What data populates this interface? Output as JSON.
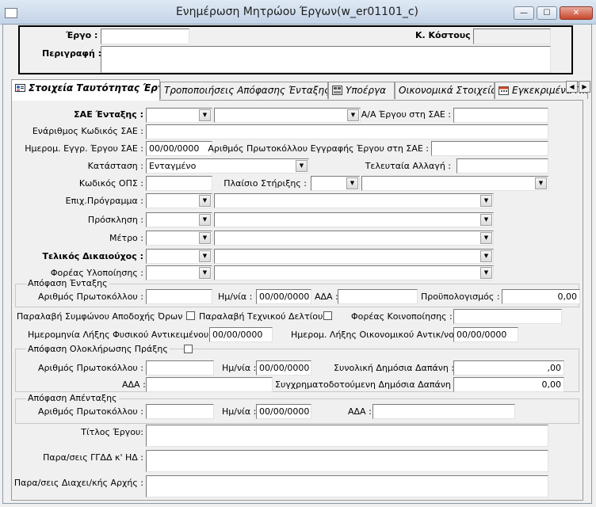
{
  "window": {
    "title": "Ενημέρωση Μητρώου Έργων(w_er01101_c)",
    "controls": {
      "minimize": "—",
      "maximize": "☐",
      "close": "✕"
    }
  },
  "header": {
    "ergo_label": "Έργο :",
    "kostous_label": "Κ. Κόστους :",
    "perigrafi_label": "Περιγραφή :"
  },
  "tabs": [
    {
      "label": "Στοιχεία Ταυτότητας Έργου",
      "icon": "id-card-icon",
      "active": true
    },
    {
      "label": "Τροποποιήσεις Απόφασης Ένταξης",
      "icon": "",
      "active": false
    },
    {
      "label": "Υποέργα",
      "icon": "subprojects-icon",
      "active": false
    },
    {
      "label": "Οικονομικά Στοιχεία",
      "icon": "",
      "active": false
    },
    {
      "label": "Εγκεκριμένα Π...",
      "icon": "calendar-icon",
      "active": false
    }
  ],
  "form": {
    "sae_entaxis_label": "ΣΑΕ Ένταξης :",
    "aa_ergou_label": "Α/Α Έργου στη ΣΑΕ :",
    "enarithmos_label": "Ενάριθμος Κωδικός ΣΑΕ :",
    "hmerom_eggr_label": "Ημερομ. Εγγρ. Έργου ΣΑΕ :",
    "hmerom_eggr_value": "00/00/0000",
    "arithmos_protokollou_eggrafis_label": "Αριθμός Πρωτοκόλλου Εγγραφής Έργου στη ΣΑΕ :",
    "katastasi_label": "Κατάσταση :",
    "katastasi_value": "Ενταγμένο",
    "teleutaia_allagi_label": "Τελευταία Αλλαγή :",
    "kodikos_ops_label": "Κωδικός ΟΠΣ :",
    "plaisio_label": "Πλαίσιο Στήριξης :",
    "epix_programma_label": "Επιχ.Πρόγραμμα :",
    "prosklisi_label": "Πρόσκληση :",
    "metro_label": "Μέτρο :",
    "telikos_dikaiouxos_label": "Τελικός Δικαιούχος :",
    "foreas_ylopoiisis_label": "Φορέας Υλοποίησης :"
  },
  "apofasi_entaxis": {
    "group_title": "Απόφαση Ένταξης",
    "arithmos_label": "Αριθμός Πρωτοκόλλου :",
    "hmnia_label": "Ημ/νία :",
    "hmnia_value": "00/00/0000",
    "ada_label": "ΑΔΑ :",
    "proypologismos_label": "Προϋπολογισμός :",
    "proypologismos_value": "0,00"
  },
  "misc": {
    "paralavi_symfonou_label": "Παραλαβή Συμφώνου Αποδοχής Όρων :",
    "paralavi_texnikou_label": "Παραλαβή Τεχνικού Δελτίου :",
    "foreas_koinopoiisis_label": "Φορέας Κοινοποίησης :",
    "hmer_lixis_fysikou_label": "Ημερομηνία Λήξης Φυσικού Αντικειμένου :",
    "hmer_lixis_fysikou_value": "00/00/0000",
    "hmer_lixis_oikonomikou_label": "Ημερομ. Λήξης Οικονομικού Αντικ/νου :",
    "hmer_lixis_oikonomikou_value": "00/00/0000"
  },
  "apofasi_oloklirosis": {
    "group_title": "Απόφαση Ολοκλήρωσης Πράξης",
    "arithmos_label": "Αριθμός Πρωτοκόλλου :",
    "hmnia_label": "Ημ/νία :",
    "hmnia_value": "00/00/0000",
    "synoliki_label": "Συνολική Δημόσια Δαπάνη :",
    "synoliki_value": ",00",
    "ada_label": "ΑΔΑ :",
    "sygxrim_label": "Συγχρηματοδοτούμενη Δημόσια Δαπάνη :",
    "sygxrim_value": "0,00"
  },
  "apofasi_apentaxis": {
    "group_title": "Απόφαση Απένταξης",
    "arithmos_label": "Αριθμός Πρωτοκόλλου :",
    "hmnia_label": "Ημ/νία :",
    "hmnia_value": "00/00/0000",
    "ada_label": "ΑΔΑ :"
  },
  "texts": {
    "titlos_label": "Τίτλος Έργου:",
    "parasis_ggdd_label": "Παρα/σεις ΓΓΔΔ κ' ΗΔ :",
    "parasis_diax_label": "Παρα/σεις Διαχει/κής Αρχής :"
  }
}
